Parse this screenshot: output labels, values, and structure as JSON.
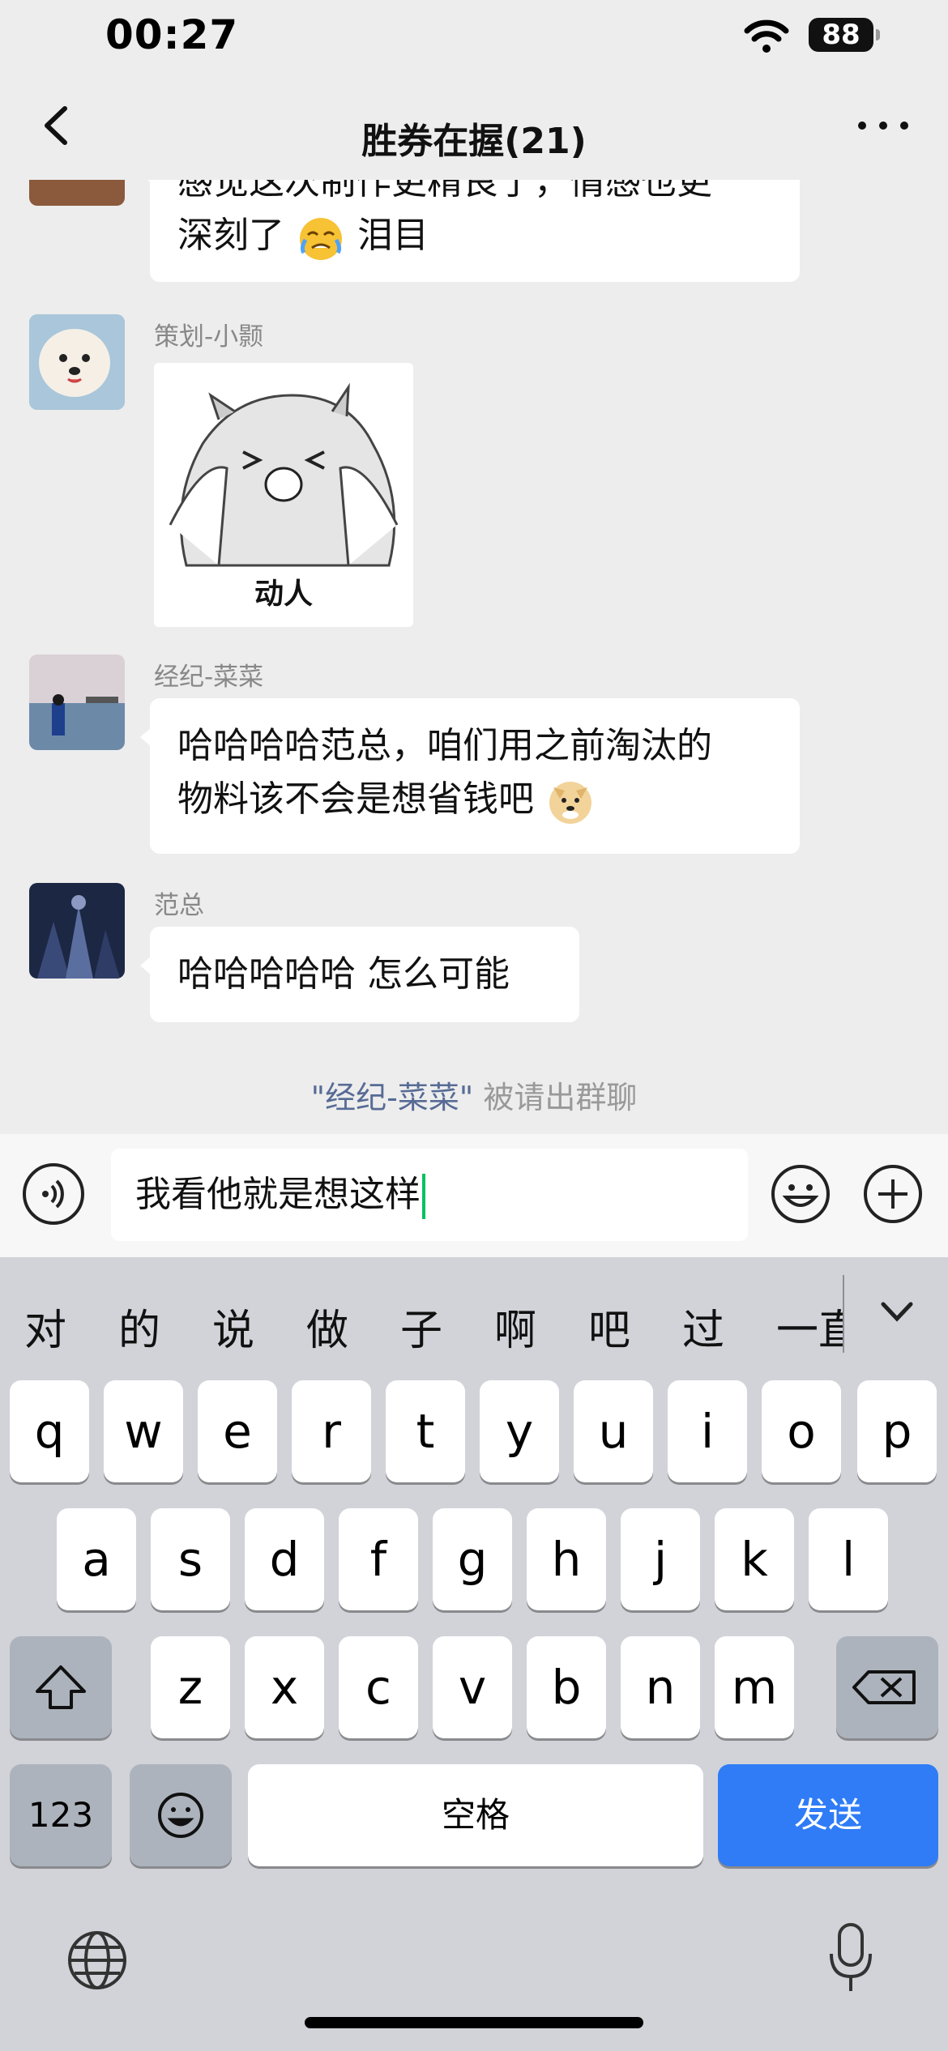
{
  "status": {
    "time": "00:27",
    "battery": "88"
  },
  "nav": {
    "title": "胜券在握(21)"
  },
  "messages": [
    {
      "text_line1": "感觉这次制作更精良了，情感也更",
      "text_line2": "深刻了",
      "text_suffix": " 泪目",
      "emoji": "crying-face"
    },
    {
      "sender": "策划-小颢",
      "sticker_caption": "动人"
    },
    {
      "sender": "经纪-菜菜",
      "text_line1": "哈哈哈哈范总，咱们用之前淘汰的",
      "text_line2": "物料该不会是想省钱吧",
      "emoji": "doge-face"
    },
    {
      "sender": "范总",
      "text": "哈哈哈哈哈 怎么可能"
    }
  ],
  "system_notice": {
    "mention": "\"经纪-菜菜\"",
    "suffix": " 被请出群聊"
  },
  "input": {
    "value": "我看他就是想这样"
  },
  "candidates": [
    "对",
    "的",
    "说",
    "做",
    "子",
    "啊",
    "吧",
    "过",
    "一直"
  ],
  "keyboard": {
    "row1": [
      "q",
      "w",
      "e",
      "r",
      "t",
      "y",
      "u",
      "i",
      "o",
      "p"
    ],
    "row2": [
      "a",
      "s",
      "d",
      "f",
      "g",
      "h",
      "j",
      "k",
      "l"
    ],
    "row3": [
      "z",
      "x",
      "c",
      "v",
      "b",
      "n",
      "m"
    ],
    "num_label": "123",
    "space_label": "空格",
    "send_label": "发送"
  },
  "colors": {
    "accent_send": "#2F7CF6",
    "caret": "#07C160",
    "mention": "#576B95"
  }
}
